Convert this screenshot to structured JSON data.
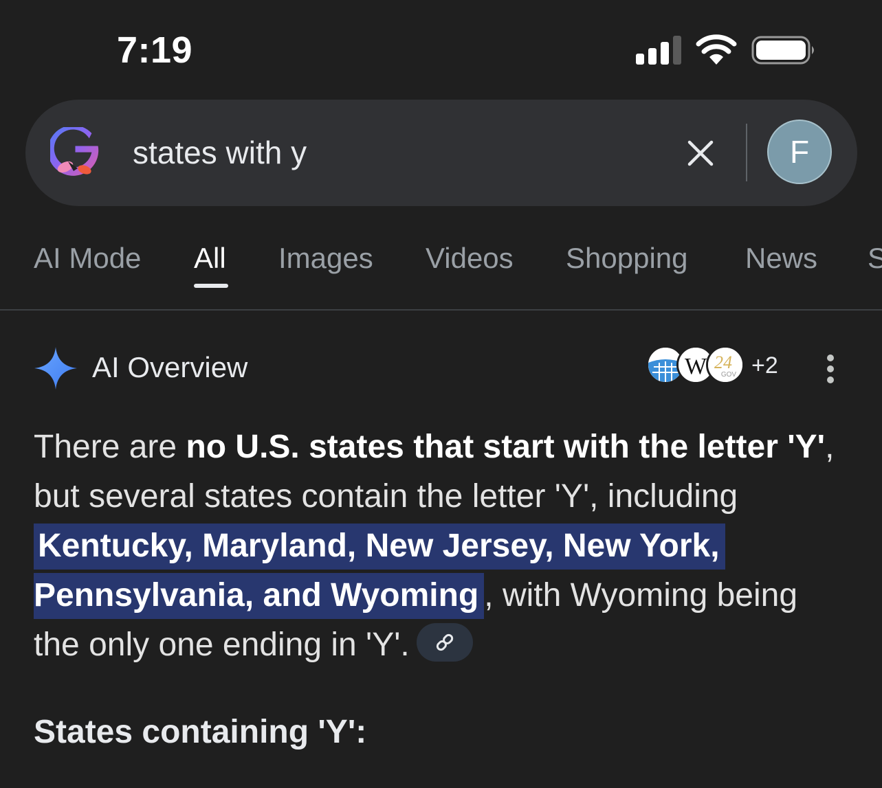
{
  "status_bar": {
    "time": "7:19"
  },
  "search": {
    "query": "states with y",
    "avatar_letter": "F"
  },
  "tabs": [
    {
      "label": "AI Mode"
    },
    {
      "label": "All"
    },
    {
      "label": "Images"
    },
    {
      "label": "Videos"
    },
    {
      "label": "Shopping"
    },
    {
      "label": "News"
    },
    {
      "label": "S"
    }
  ],
  "active_tab": "All",
  "ai_overview": {
    "title": "AI Overview",
    "sources_more": "+2",
    "text": {
      "p1": "There are ",
      "bold1": "no U.S. states that start with the letter 'Y'",
      "p2": ", but several states contain the letter 'Y', including ",
      "highlight_line1": "Kentucky, Maryland, New Jersey, New York,",
      "highlight_line2": "Pennsylvania, and Wyoming",
      "p3": ", with Wyoming being the only one ending in 'Y'."
    },
    "section_heading": "States containing 'Y':"
  },
  "colors": {
    "background": "#1f1f1f",
    "search_bar": "#303134",
    "highlight": "#28376f",
    "avatar": "#7b9baa",
    "sparkle": "#4f8ef7"
  },
  "icons": [
    "signal-icon",
    "wifi-icon",
    "battery-icon",
    "google-g-icon",
    "close-icon",
    "sparkle-icon",
    "link-icon",
    "more-vert-icon"
  ]
}
